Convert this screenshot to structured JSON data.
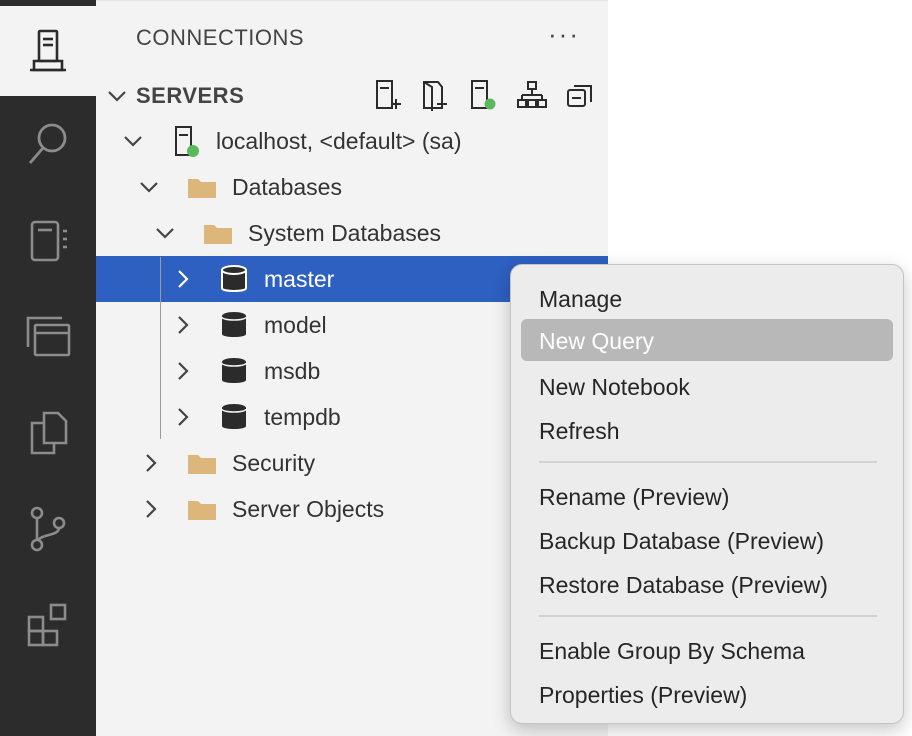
{
  "sidebar": {
    "title": "CONNECTIONS",
    "more_label": "···",
    "section": {
      "label": "SERVERS",
      "toolbar_icons": [
        "new-connection-icon",
        "new-server-group-icon",
        "active-connections-icon",
        "show-hierarchy-icon",
        "collapse-all-icon"
      ]
    }
  },
  "tree": {
    "server": {
      "label": "localhost, <default> (sa)",
      "status_color": "#5cb85c"
    },
    "databases": "Databases",
    "system_databases": "System Databases",
    "dbs": [
      "master",
      "model",
      "msdb",
      "tempdb"
    ],
    "security": "Security",
    "server_objects": "Server Objects"
  },
  "context_menu": {
    "items": [
      "Manage",
      "New Query",
      "New Notebook",
      "Refresh",
      "Rename (Preview)",
      "Backup Database (Preview)",
      "Restore Database (Preview)",
      "Enable Group By Schema",
      "Properties (Preview)"
    ],
    "highlighted": "New Query"
  },
  "colors": {
    "selection": "#2e60c2",
    "folder": "#dcb67a",
    "activity_bar": "#2c2c2c",
    "sidebar": "#f3f3f3"
  }
}
